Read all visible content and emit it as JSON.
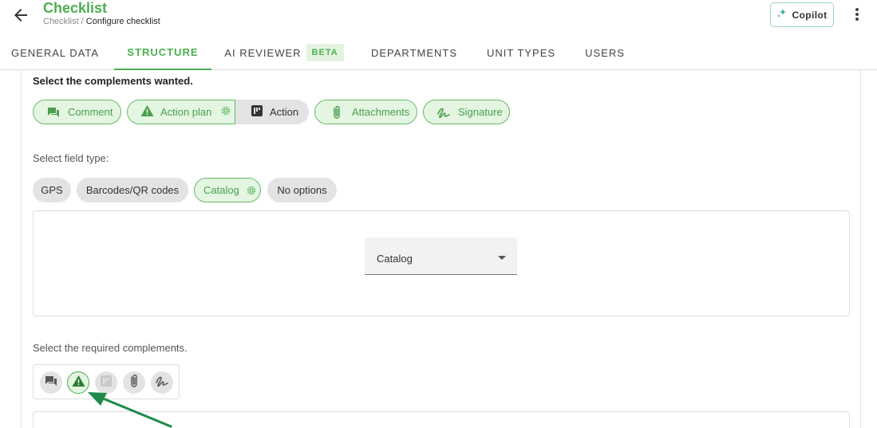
{
  "header": {
    "title": "Checklist",
    "breadcrumb_parent": "Checklist / ",
    "breadcrumb_current": "Configure checklist",
    "copilot_label": "Copilot"
  },
  "tabs": [
    {
      "label": "GENERAL DATA",
      "active": false
    },
    {
      "label": "STRUCTURE",
      "active": true
    },
    {
      "label": "AI REVIEWER",
      "badge": "BETA",
      "active": false
    },
    {
      "label": "DEPARTMENTS",
      "active": false
    },
    {
      "label": "UNIT TYPES",
      "active": false
    },
    {
      "label": "USERS",
      "active": false
    }
  ],
  "complements": {
    "title": "Select the complements wanted.",
    "items": [
      {
        "label": "Comment",
        "icon": "comment-icon",
        "selected": true
      },
      {
        "label": "Action plan",
        "icon": "warning-icon",
        "selected": true,
        "settings": true
      },
      {
        "label": "Action",
        "icon": "board-icon",
        "selected": false
      },
      {
        "label": "Attachments",
        "icon": "paperclip-icon",
        "selected": true
      },
      {
        "label": "Signature",
        "icon": "signature-icon",
        "selected": true
      }
    ]
  },
  "field_type": {
    "title": "Select field type:",
    "options": [
      {
        "label": "GPS",
        "selected": false
      },
      {
        "label": "Barcodes/QR codes",
        "selected": false
      },
      {
        "label": "Catalog",
        "selected": true,
        "settings": true
      },
      {
        "label": "No options",
        "selected": false
      }
    ],
    "catalog_select_value": "Catalog"
  },
  "required": {
    "title": "Select the required complements.",
    "icons": [
      "comment-icon",
      "warning-icon",
      "board-icon",
      "paperclip-icon",
      "signature-icon"
    ],
    "active_index": 1
  },
  "colors": {
    "accent": "#4caf50",
    "chip_selected_bg": "#e4f5e1",
    "arrow": "#1e8a4c"
  }
}
